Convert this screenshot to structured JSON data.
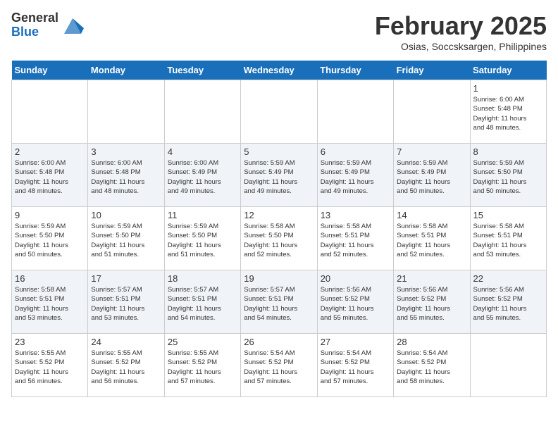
{
  "logo": {
    "general": "General",
    "blue": "Blue"
  },
  "title": "February 2025",
  "subtitle": "Osias, Soccsksargen, Philippines",
  "weekdays": [
    "Sunday",
    "Monday",
    "Tuesday",
    "Wednesday",
    "Thursday",
    "Friday",
    "Saturday"
  ],
  "weeks": [
    [
      {
        "day": "",
        "info": ""
      },
      {
        "day": "",
        "info": ""
      },
      {
        "day": "",
        "info": ""
      },
      {
        "day": "",
        "info": ""
      },
      {
        "day": "",
        "info": ""
      },
      {
        "day": "",
        "info": ""
      },
      {
        "day": "1",
        "info": "Sunrise: 6:00 AM\nSunset: 5:48 PM\nDaylight: 11 hours\nand 48 minutes."
      }
    ],
    [
      {
        "day": "2",
        "info": "Sunrise: 6:00 AM\nSunset: 5:48 PM\nDaylight: 11 hours\nand 48 minutes."
      },
      {
        "day": "3",
        "info": "Sunrise: 6:00 AM\nSunset: 5:48 PM\nDaylight: 11 hours\nand 48 minutes."
      },
      {
        "day": "4",
        "info": "Sunrise: 6:00 AM\nSunset: 5:49 PM\nDaylight: 11 hours\nand 49 minutes."
      },
      {
        "day": "5",
        "info": "Sunrise: 5:59 AM\nSunset: 5:49 PM\nDaylight: 11 hours\nand 49 minutes."
      },
      {
        "day": "6",
        "info": "Sunrise: 5:59 AM\nSunset: 5:49 PM\nDaylight: 11 hours\nand 49 minutes."
      },
      {
        "day": "7",
        "info": "Sunrise: 5:59 AM\nSunset: 5:49 PM\nDaylight: 11 hours\nand 50 minutes."
      },
      {
        "day": "8",
        "info": "Sunrise: 5:59 AM\nSunset: 5:50 PM\nDaylight: 11 hours\nand 50 minutes."
      }
    ],
    [
      {
        "day": "9",
        "info": "Sunrise: 5:59 AM\nSunset: 5:50 PM\nDaylight: 11 hours\nand 50 minutes."
      },
      {
        "day": "10",
        "info": "Sunrise: 5:59 AM\nSunset: 5:50 PM\nDaylight: 11 hours\nand 51 minutes."
      },
      {
        "day": "11",
        "info": "Sunrise: 5:59 AM\nSunset: 5:50 PM\nDaylight: 11 hours\nand 51 minutes."
      },
      {
        "day": "12",
        "info": "Sunrise: 5:58 AM\nSunset: 5:50 PM\nDaylight: 11 hours\nand 52 minutes."
      },
      {
        "day": "13",
        "info": "Sunrise: 5:58 AM\nSunset: 5:51 PM\nDaylight: 11 hours\nand 52 minutes."
      },
      {
        "day": "14",
        "info": "Sunrise: 5:58 AM\nSunset: 5:51 PM\nDaylight: 11 hours\nand 52 minutes."
      },
      {
        "day": "15",
        "info": "Sunrise: 5:58 AM\nSunset: 5:51 PM\nDaylight: 11 hours\nand 53 minutes."
      }
    ],
    [
      {
        "day": "16",
        "info": "Sunrise: 5:58 AM\nSunset: 5:51 PM\nDaylight: 11 hours\nand 53 minutes."
      },
      {
        "day": "17",
        "info": "Sunrise: 5:57 AM\nSunset: 5:51 PM\nDaylight: 11 hours\nand 53 minutes."
      },
      {
        "day": "18",
        "info": "Sunrise: 5:57 AM\nSunset: 5:51 PM\nDaylight: 11 hours\nand 54 minutes."
      },
      {
        "day": "19",
        "info": "Sunrise: 5:57 AM\nSunset: 5:51 PM\nDaylight: 11 hours\nand 54 minutes."
      },
      {
        "day": "20",
        "info": "Sunrise: 5:56 AM\nSunset: 5:52 PM\nDaylight: 11 hours\nand 55 minutes."
      },
      {
        "day": "21",
        "info": "Sunrise: 5:56 AM\nSunset: 5:52 PM\nDaylight: 11 hours\nand 55 minutes."
      },
      {
        "day": "22",
        "info": "Sunrise: 5:56 AM\nSunset: 5:52 PM\nDaylight: 11 hours\nand 55 minutes."
      }
    ],
    [
      {
        "day": "23",
        "info": "Sunrise: 5:55 AM\nSunset: 5:52 PM\nDaylight: 11 hours\nand 56 minutes."
      },
      {
        "day": "24",
        "info": "Sunrise: 5:55 AM\nSunset: 5:52 PM\nDaylight: 11 hours\nand 56 minutes."
      },
      {
        "day": "25",
        "info": "Sunrise: 5:55 AM\nSunset: 5:52 PM\nDaylight: 11 hours\nand 57 minutes."
      },
      {
        "day": "26",
        "info": "Sunrise: 5:54 AM\nSunset: 5:52 PM\nDaylight: 11 hours\nand 57 minutes."
      },
      {
        "day": "27",
        "info": "Sunrise: 5:54 AM\nSunset: 5:52 PM\nDaylight: 11 hours\nand 57 minutes."
      },
      {
        "day": "28",
        "info": "Sunrise: 5:54 AM\nSunset: 5:52 PM\nDaylight: 11 hours\nand 58 minutes."
      },
      {
        "day": "",
        "info": ""
      }
    ]
  ]
}
